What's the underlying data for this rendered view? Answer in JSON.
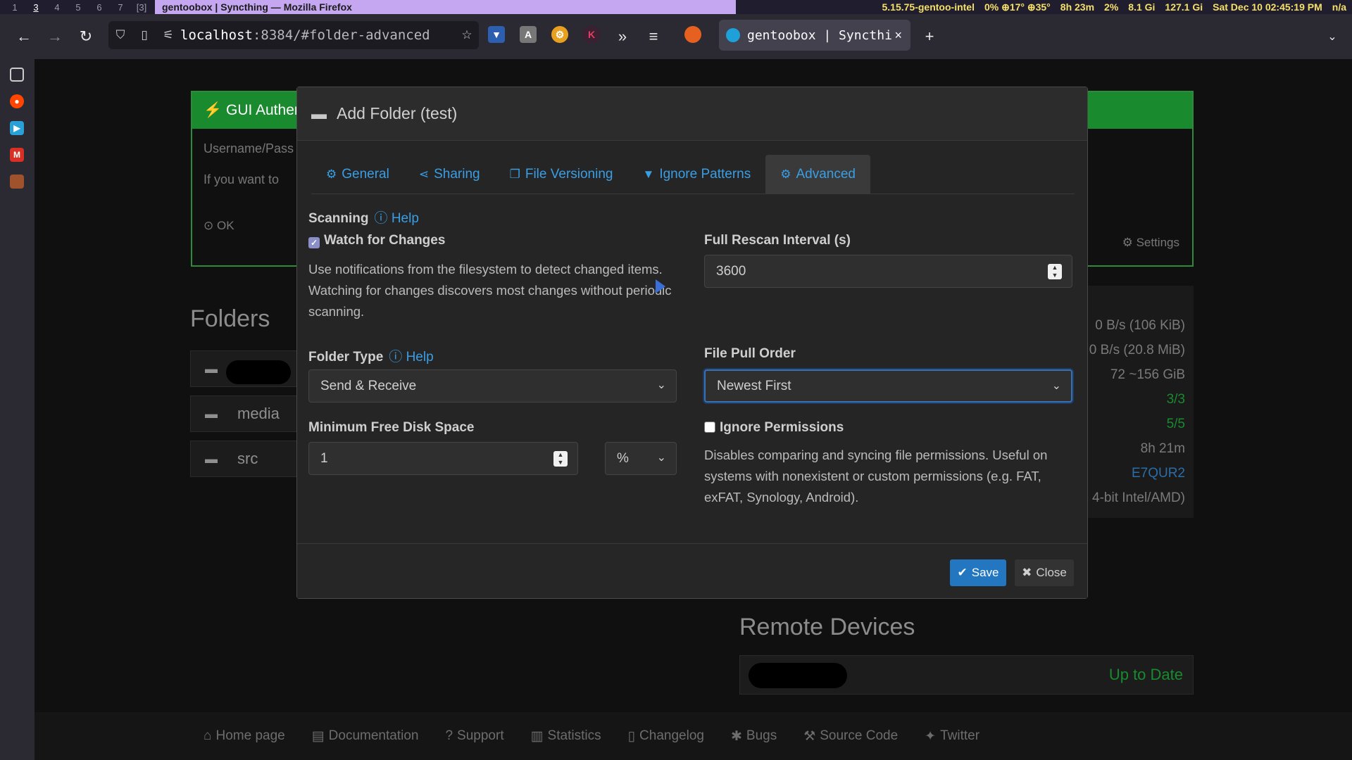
{
  "sysbar": {
    "workspaces": [
      "1",
      "3",
      "4",
      "5",
      "6",
      "7",
      "[3]"
    ],
    "window_title": "gentoobox | Syncthing — Mozilla Firefox",
    "kernel": "5.15.75-gentoo-intel",
    "cpu": "0% ⊕17° ⊕35°",
    "uptime": "8h 23m",
    "load": "2%",
    "mem": "8.1 Gi",
    "disk": "127.1 Gi",
    "datetime": "Sat Dec 10 02:45:19 PM",
    "extra": "n/a"
  },
  "browser": {
    "url_host": "localhost",
    "url_path": ":8384/#folder-advanced",
    "tab_title": "gentoobox | Syncthi",
    "colors": {
      "accent": "#3a9ee5",
      "ok_green": "#1a8a2e"
    }
  },
  "background": {
    "panel_header": "⚡ GUI Authen",
    "panel_line1": "Username/Pass",
    "panel_line2": "If you want to",
    "ok": "OK",
    "settings": "Settings",
    "folders_title": "Folders",
    "folders": [
      "media",
      "src"
    ],
    "right_lines": [
      "0 B/s (106 KiB)",
      "0 B/s (20.8 MiB)",
      "72  ~156 GiB",
      "3/3",
      "5/5",
      "8h 21m",
      "E7QUR2",
      "4-bit Intel/AMD)"
    ],
    "remote_title": "Remote Devices",
    "remote_status": "Up to Date"
  },
  "footer": [
    "Home page",
    "Documentation",
    "Support",
    "Statistics",
    "Changelog",
    "Bugs",
    "Source Code",
    "Twitter"
  ],
  "modal": {
    "title": "Add Folder (test)",
    "tabs": [
      {
        "label": "General",
        "icon": "gear-icon"
      },
      {
        "label": "Sharing",
        "icon": "share-icon"
      },
      {
        "label": "File Versioning",
        "icon": "copy-icon"
      },
      {
        "label": "Ignore Patterns",
        "icon": "filter-icon"
      },
      {
        "label": "Advanced",
        "icon": "gears-icon"
      }
    ],
    "scanning_label": "Scanning",
    "help": "Help",
    "watch_label": "Watch for Changes",
    "watch_desc": "Use notifications from the filesystem to detect changed items. Watching for changes discovers most changes without periodic scanning.",
    "rescan_label": "Full Rescan Interval (s)",
    "rescan_value": "3600",
    "folder_type_label": "Folder Type",
    "folder_type_value": "Send & Receive",
    "pull_order_label": "File Pull Order",
    "pull_order_value": "Newest First",
    "min_disk_label": "Minimum Free Disk Space",
    "min_disk_value": "1",
    "min_disk_unit": "%",
    "ignore_perms_label": "Ignore Permissions",
    "ignore_perms_desc": "Disables comparing and syncing file permissions. Useful on systems with nonexistent or custom permissions (e.g. FAT, exFAT, Synology, Android).",
    "save": "Save",
    "close": "Close"
  }
}
